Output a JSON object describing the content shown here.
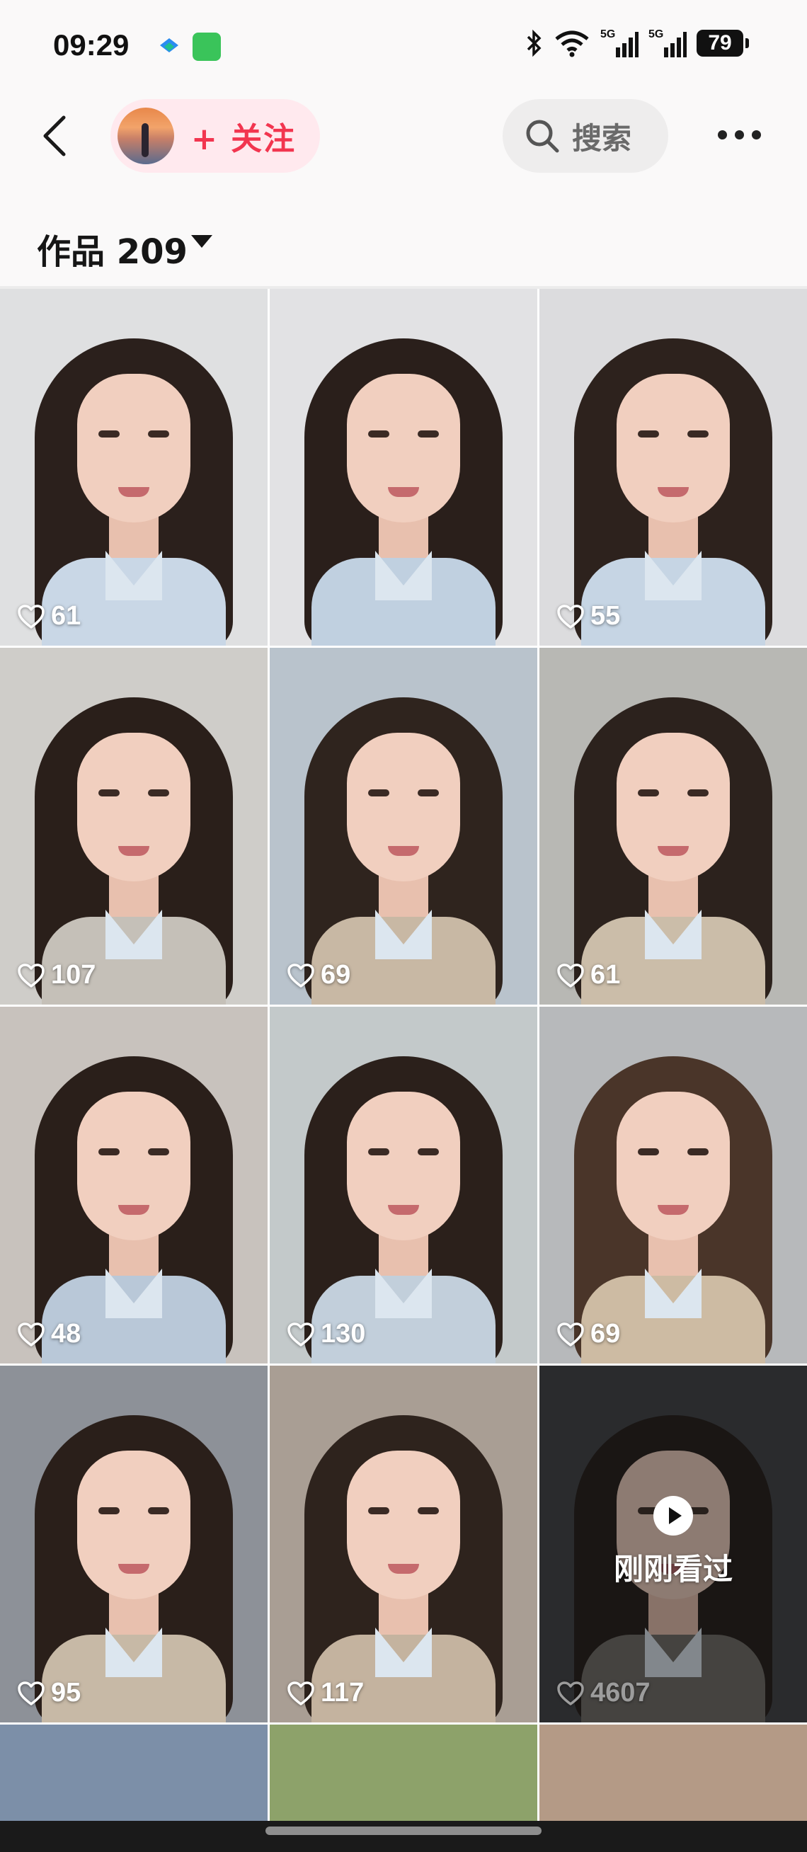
{
  "status_bar": {
    "time": "09:29",
    "battery": "79",
    "icons": [
      "bluetooth-icon",
      "wifi-icon",
      "5g-signal-icon",
      "5g-signal-icon"
    ]
  },
  "header": {
    "follow_label": "+ 关注",
    "search_label": "搜索"
  },
  "works": {
    "label": "作品 209"
  },
  "grid": [
    {
      "likes": "61",
      "bg": "#dfe0e1",
      "hair": "#2b201c",
      "shirt": "#c9d7e6"
    },
    {
      "likes": "",
      "bg": "#e2e2e4",
      "hair": "#2a1f1b",
      "shirt": "#c0d0e0"
    },
    {
      "likes": "55",
      "bg": "#dcdcde",
      "hair": "#2d221d",
      "shirt": "#c6d5e4"
    },
    {
      "likes": "107",
      "bg": "#cfcdc9",
      "hair": "#2a1f1a",
      "shirt": "#c5c0b8"
    },
    {
      "likes": "69",
      "bg": "#b9c3cc",
      "hair": "#2f241e",
      "shirt": "#c8b8a4"
    },
    {
      "likes": "61",
      "bg": "#b8b8b4",
      "hair": "#2c221d",
      "shirt": "#cbbda9"
    },
    {
      "likes": "48",
      "bg": "#c8c2bd",
      "hair": "#2a1f1a",
      "shirt": "#b9c8d8"
    },
    {
      "likes": "130",
      "bg": "#c3c9ca",
      "hair": "#2b201b",
      "shirt": "#c2cfdb"
    },
    {
      "likes": "69",
      "bg": "#b7b9bb",
      "hair": "#4a3529",
      "shirt": "#cdbba3"
    },
    {
      "likes": "95",
      "bg": "#8d9198",
      "hair": "#2a1f1a",
      "shirt": "#c7b9a6"
    },
    {
      "likes": "117",
      "bg": "#a99e94",
      "hair": "#2e231d",
      "shirt": "#c4b39f"
    },
    {
      "likes": "4607",
      "bg": "#3c3e42",
      "hair": "#1f1815",
      "shirt": "#6e6a64",
      "watched": true
    }
  ],
  "watched": {
    "label": "刚刚看过"
  }
}
